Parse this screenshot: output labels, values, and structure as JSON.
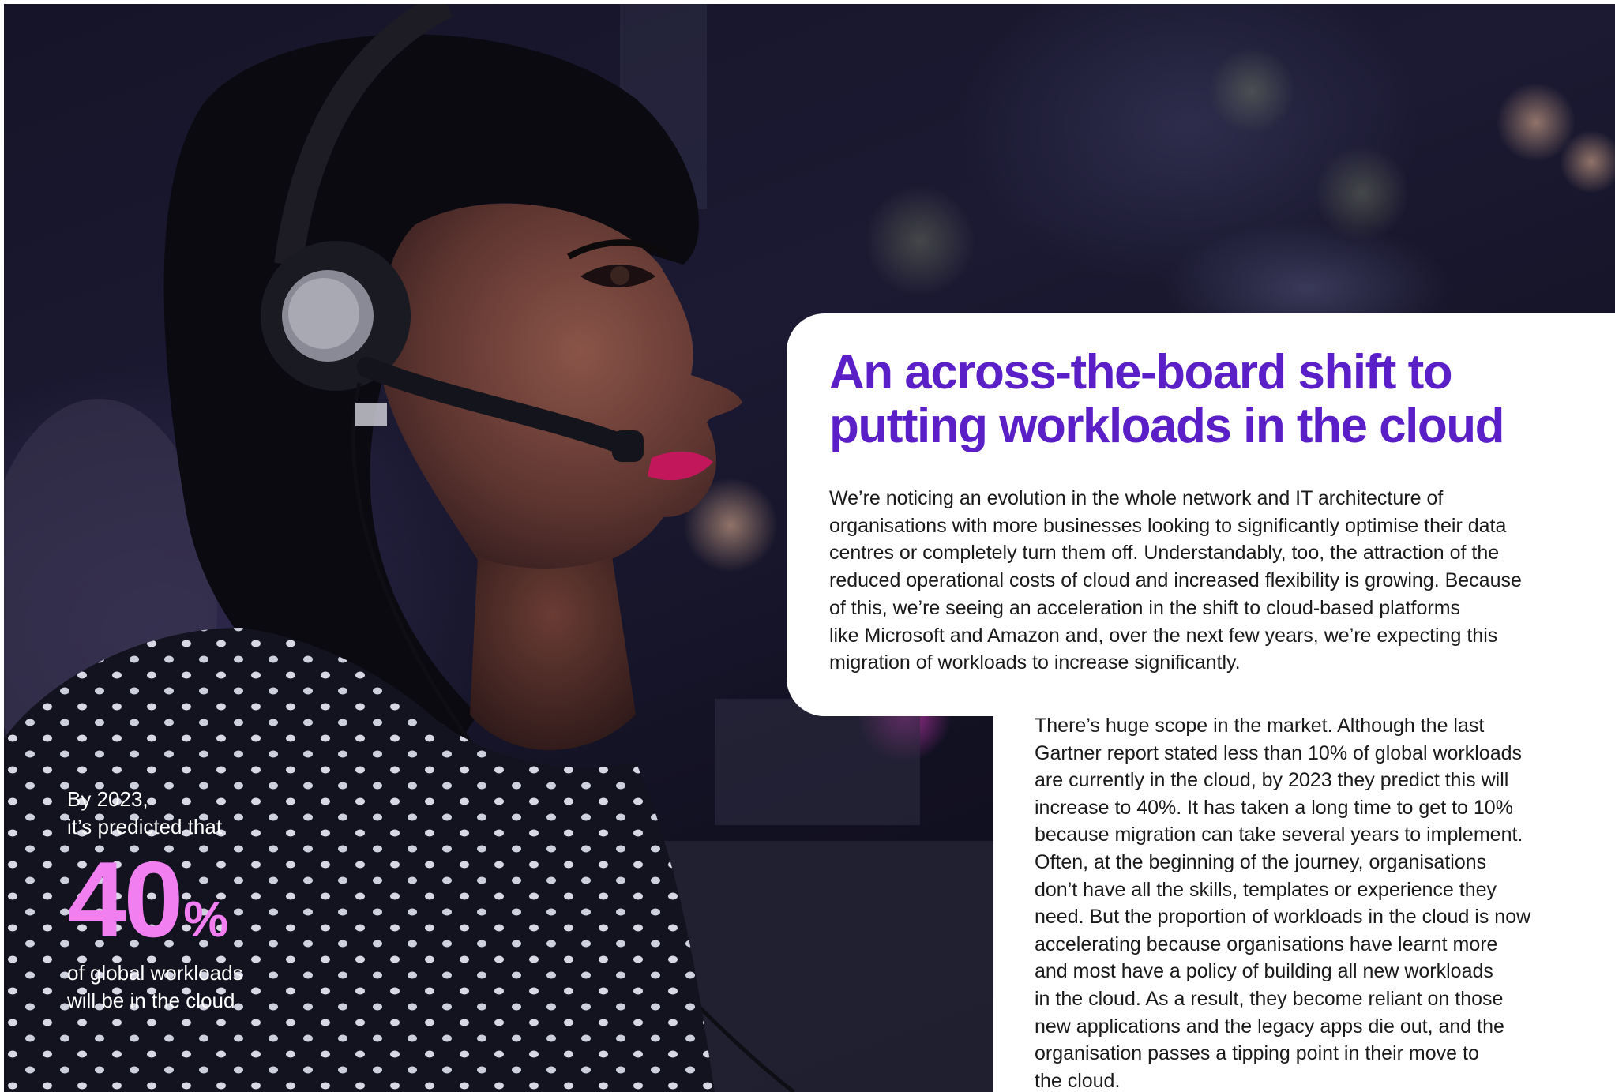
{
  "colors": {
    "headline": "#5b1fc7",
    "stat_accent": "#f27ff0",
    "body_text": "#1a1a1a",
    "card_background": "#ffffff"
  },
  "stat": {
    "intro_lines": [
      "By 2023,",
      "it’s predicted that"
    ],
    "number": "40",
    "unit": "%",
    "outro_lines": [
      "of global workloads",
      "will be in the cloud"
    ]
  },
  "article": {
    "headline_lines": [
      "An across-the-board shift to",
      "putting workloads in the cloud"
    ],
    "lead_lines": [
      "We’re noticing an evolution in the whole network and IT architecture of",
      "organisations with more businesses looking to significantly optimise their data",
      "centres or completely turn them off. Understandably, too, the attraction of the",
      "reduced operational costs of cloud and increased flexibility is growing. Because",
      "of this, we’re seeing an acceleration in the shift to cloud-based platforms",
      "like Microsoft and Amazon and, over the next few years, we’re expecting this",
      "migration of workloads to increase significantly."
    ],
    "body_lines": [
      "There’s huge scope in the market. Although the last",
      "Gartner report stated less than 10% of global workloads",
      "are currently in the cloud, by 2023 they predict this will",
      "increase to 40%. It has taken a long time to get to 10%",
      "because migration can take several years to implement.",
      "Often, at the beginning of the journey, organisations",
      "don’t have all the skills, templates or experience they",
      "need. But the proportion of workloads in the cloud is now",
      "accelerating because organisations have learnt more",
      "and most have a policy of building all new workloads",
      "in the cloud. As a result, they become reliant on those",
      "new applications and the legacy apps die out, and the",
      "organisation passes a tipping point in their move to",
      "the cloud."
    ]
  }
}
